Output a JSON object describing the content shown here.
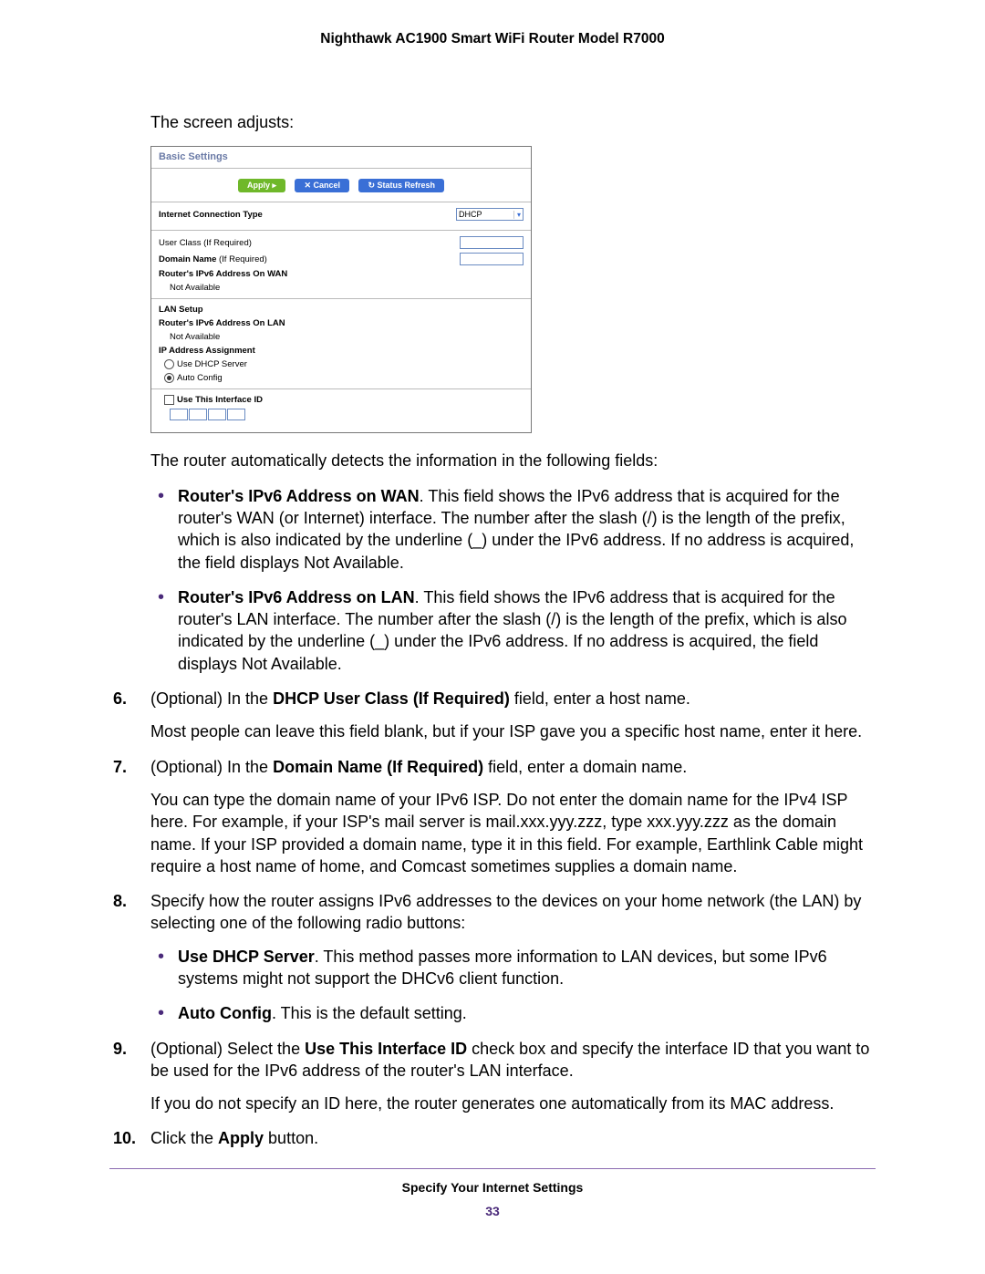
{
  "header": "Nighthawk AC1900 Smart WiFi Router Model R7000",
  "intro1": "The screen adjusts:",
  "screenshot": {
    "title": "Basic Settings",
    "buttons": {
      "apply": "Apply ▸",
      "cancel": "✕ Cancel",
      "status": "↻ Status Refresh"
    },
    "rows": {
      "ict_label": "Internet Connection Type",
      "ict_value": "DHCP",
      "user_class": "User Class (If Required)",
      "domain_label": "Domain Name",
      "domain_suffix": "(If Required)",
      "wan_addr_label": "Router's IPv6 Address On WAN",
      "not_available": "Not Available",
      "lan_setup": "LAN Setup",
      "lan_addr_label": "Router's IPv6 Address On LAN",
      "ip_assign": "IP Address Assignment",
      "use_dhcp": "Use DHCP Server",
      "auto_config": "Auto Config",
      "use_iface": "Use This Interface ID"
    }
  },
  "para_detect": "The router automatically detects the information in the following fields:",
  "bullets_detect": [
    {
      "b": "Router's IPv6 Address on WAN",
      "t": ". This field shows the IPv6 address that is acquired for the router's WAN (or Internet) interface. The number after the slash (/) is the length of the prefix, which is also indicated by the underline (_) under the IPv6 address. If no address is acquired, the field displays Not Available."
    },
    {
      "b": "Router's IPv6 Address on LAN",
      "t": ". This field shows the IPv6 address that is acquired for the router's LAN interface. The number after the slash (/) is the length of the prefix, which is also indicated by the underline (_) under the IPv6 address. If no address is acquired, the field displays Not Available."
    }
  ],
  "steps": {
    "s6": {
      "num": "6.",
      "l1a": "(Optional) In the ",
      "l1b": "DHCP User Class (If Required)",
      "l1c": " field, enter a host name.",
      "l2": "Most people can leave this field blank, but if your ISP gave you a specific host name, enter it here."
    },
    "s7": {
      "num": "7.",
      "l1a": "(Optional) In the ",
      "l1b": "Domain Name (If Required)",
      "l1c": " field, enter a domain name.",
      "l2": "You can type the domain name of your IPv6 ISP. Do not enter the domain name for the IPv4 ISP here. For example, if your ISP's mail server is mail.xxx.yyy.zzz, type xxx.yyy.zzz as the domain name. If your ISP provided a domain name, type it in this field. For example, Earthlink Cable might require a host name of home, and Comcast sometimes supplies a domain name."
    },
    "s8": {
      "num": "8.",
      "l1": "Specify how the router assigns IPv6 addresses to the devices on your home network (the LAN) by selecting one of the following radio buttons:",
      "b1a": "Use DHCP Server",
      "b1b": ". This method passes more information to LAN devices, but some IPv6 systems might not support the DHCv6 client function.",
      "b2a": "Auto Config",
      "b2b": ". This is the default setting."
    },
    "s9": {
      "num": "9.",
      "l1a": "(Optional) Select the ",
      "l1b": "Use This Interface ID",
      "l1c": " check box and specify the interface ID that you want to be used for the IPv6 address of the router's LAN interface.",
      "l2": "If you do not specify an ID here, the router generates one automatically from its MAC address."
    },
    "s10": {
      "num": "10.",
      "l1a": "Click the ",
      "l1b": "Apply",
      "l1c": " button."
    }
  },
  "footer": {
    "section": "Specify Your Internet Settings",
    "page": "33"
  }
}
